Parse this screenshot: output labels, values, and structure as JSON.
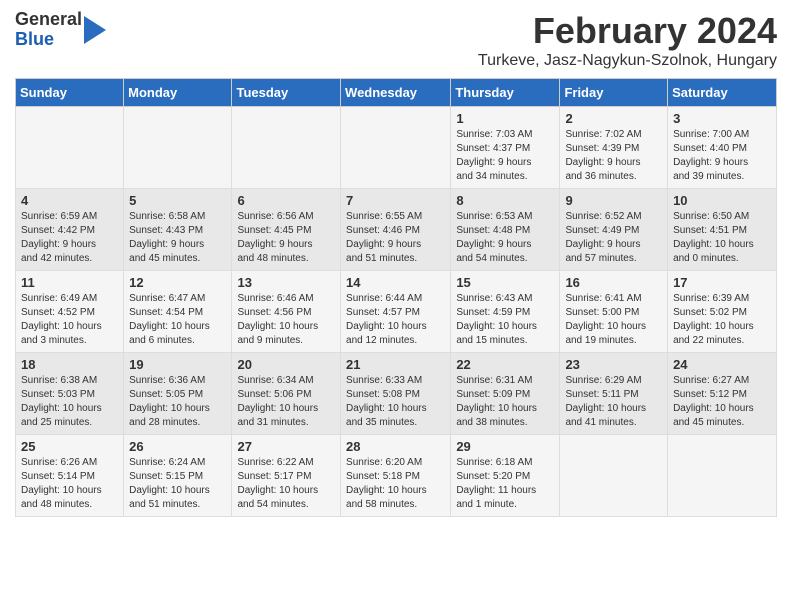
{
  "header": {
    "logo_general": "General",
    "logo_blue": "Blue",
    "month": "February 2024",
    "location": "Turkeve, Jasz-Nagykun-Szolnok, Hungary"
  },
  "columns": [
    "Sunday",
    "Monday",
    "Tuesday",
    "Wednesday",
    "Thursday",
    "Friday",
    "Saturday"
  ],
  "weeks": [
    [
      {
        "day": "",
        "info": ""
      },
      {
        "day": "",
        "info": ""
      },
      {
        "day": "",
        "info": ""
      },
      {
        "day": "",
        "info": ""
      },
      {
        "day": "1",
        "info": "Sunrise: 7:03 AM\nSunset: 4:37 PM\nDaylight: 9 hours\nand 34 minutes."
      },
      {
        "day": "2",
        "info": "Sunrise: 7:02 AM\nSunset: 4:39 PM\nDaylight: 9 hours\nand 36 minutes."
      },
      {
        "day": "3",
        "info": "Sunrise: 7:00 AM\nSunset: 4:40 PM\nDaylight: 9 hours\nand 39 minutes."
      }
    ],
    [
      {
        "day": "4",
        "info": "Sunrise: 6:59 AM\nSunset: 4:42 PM\nDaylight: 9 hours\nand 42 minutes."
      },
      {
        "day": "5",
        "info": "Sunrise: 6:58 AM\nSunset: 4:43 PM\nDaylight: 9 hours\nand 45 minutes."
      },
      {
        "day": "6",
        "info": "Sunrise: 6:56 AM\nSunset: 4:45 PM\nDaylight: 9 hours\nand 48 minutes."
      },
      {
        "day": "7",
        "info": "Sunrise: 6:55 AM\nSunset: 4:46 PM\nDaylight: 9 hours\nand 51 minutes."
      },
      {
        "day": "8",
        "info": "Sunrise: 6:53 AM\nSunset: 4:48 PM\nDaylight: 9 hours\nand 54 minutes."
      },
      {
        "day": "9",
        "info": "Sunrise: 6:52 AM\nSunset: 4:49 PM\nDaylight: 9 hours\nand 57 minutes."
      },
      {
        "day": "10",
        "info": "Sunrise: 6:50 AM\nSunset: 4:51 PM\nDaylight: 10 hours\nand 0 minutes."
      }
    ],
    [
      {
        "day": "11",
        "info": "Sunrise: 6:49 AM\nSunset: 4:52 PM\nDaylight: 10 hours\nand 3 minutes."
      },
      {
        "day": "12",
        "info": "Sunrise: 6:47 AM\nSunset: 4:54 PM\nDaylight: 10 hours\nand 6 minutes."
      },
      {
        "day": "13",
        "info": "Sunrise: 6:46 AM\nSunset: 4:56 PM\nDaylight: 10 hours\nand 9 minutes."
      },
      {
        "day": "14",
        "info": "Sunrise: 6:44 AM\nSunset: 4:57 PM\nDaylight: 10 hours\nand 12 minutes."
      },
      {
        "day": "15",
        "info": "Sunrise: 6:43 AM\nSunset: 4:59 PM\nDaylight: 10 hours\nand 15 minutes."
      },
      {
        "day": "16",
        "info": "Sunrise: 6:41 AM\nSunset: 5:00 PM\nDaylight: 10 hours\nand 19 minutes."
      },
      {
        "day": "17",
        "info": "Sunrise: 6:39 AM\nSunset: 5:02 PM\nDaylight: 10 hours\nand 22 minutes."
      }
    ],
    [
      {
        "day": "18",
        "info": "Sunrise: 6:38 AM\nSunset: 5:03 PM\nDaylight: 10 hours\nand 25 minutes."
      },
      {
        "day": "19",
        "info": "Sunrise: 6:36 AM\nSunset: 5:05 PM\nDaylight: 10 hours\nand 28 minutes."
      },
      {
        "day": "20",
        "info": "Sunrise: 6:34 AM\nSunset: 5:06 PM\nDaylight: 10 hours\nand 31 minutes."
      },
      {
        "day": "21",
        "info": "Sunrise: 6:33 AM\nSunset: 5:08 PM\nDaylight: 10 hours\nand 35 minutes."
      },
      {
        "day": "22",
        "info": "Sunrise: 6:31 AM\nSunset: 5:09 PM\nDaylight: 10 hours\nand 38 minutes."
      },
      {
        "day": "23",
        "info": "Sunrise: 6:29 AM\nSunset: 5:11 PM\nDaylight: 10 hours\nand 41 minutes."
      },
      {
        "day": "24",
        "info": "Sunrise: 6:27 AM\nSunset: 5:12 PM\nDaylight: 10 hours\nand 45 minutes."
      }
    ],
    [
      {
        "day": "25",
        "info": "Sunrise: 6:26 AM\nSunset: 5:14 PM\nDaylight: 10 hours\nand 48 minutes."
      },
      {
        "day": "26",
        "info": "Sunrise: 6:24 AM\nSunset: 5:15 PM\nDaylight: 10 hours\nand 51 minutes."
      },
      {
        "day": "27",
        "info": "Sunrise: 6:22 AM\nSunset: 5:17 PM\nDaylight: 10 hours\nand 54 minutes."
      },
      {
        "day": "28",
        "info": "Sunrise: 6:20 AM\nSunset: 5:18 PM\nDaylight: 10 hours\nand 58 minutes."
      },
      {
        "day": "29",
        "info": "Sunrise: 6:18 AM\nSunset: 5:20 PM\nDaylight: 11 hours\nand 1 minute."
      },
      {
        "day": "",
        "info": ""
      },
      {
        "day": "",
        "info": ""
      }
    ]
  ]
}
